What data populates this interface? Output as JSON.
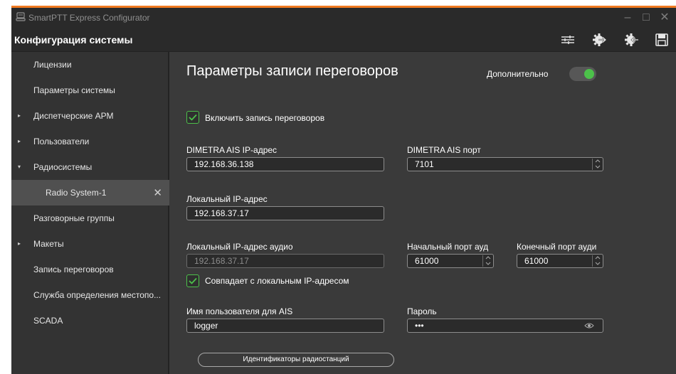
{
  "window": {
    "title": "SmartPTT Express Configurator",
    "accent_color": "#f07a21",
    "controls": {
      "minimize": "–",
      "maximize": "□",
      "close": "✕"
    }
  },
  "toolbar": {
    "section_title": "Конфигурация системы",
    "buttons": [
      "settings-sliders-icon",
      "export-icon",
      "import-icon",
      "save-icon"
    ]
  },
  "sidebar": {
    "items": [
      {
        "label": "Лицензии",
        "caret": ""
      },
      {
        "label": "Параметры системы",
        "caret": ""
      },
      {
        "label": "Диспетчерские АРМ",
        "caret": "▸"
      },
      {
        "label": "Пользователи",
        "caret": "▸"
      },
      {
        "label": "Радиосистемы",
        "caret": "▾"
      },
      {
        "label": "Radio System-1",
        "caret": "",
        "close": "✕"
      },
      {
        "label": "Разговорные группы",
        "caret": ""
      },
      {
        "label": "Макеты",
        "caret": "▸"
      },
      {
        "label": "Запись переговоров",
        "caret": ""
      },
      {
        "label": "Служба определения местопо...",
        "caret": ""
      },
      {
        "label": "SCADA",
        "caret": ""
      }
    ]
  },
  "main": {
    "title": "Параметры записи переговоров",
    "advanced_label": "Дополнительно",
    "advanced_on": true,
    "enable_recording": {
      "label": "Включить запись переговоров",
      "checked": true
    },
    "ais_ip": {
      "label": "DIMETRA AIS IP-адрес",
      "value": "192.168.36.138"
    },
    "ais_port": {
      "label": "DIMETRA AIS порт",
      "value": "7101"
    },
    "local_ip": {
      "label": "Локальный IP-адрес",
      "value": "192.168.37.17"
    },
    "local_audio_ip": {
      "label": "Локальный IP-адрес аудио",
      "value": "192.168.37.17"
    },
    "start_port": {
      "label": "Начальный порт ауд",
      "value": "61000"
    },
    "end_port": {
      "label": "Конечный порт ауди",
      "value": "61000"
    },
    "same_as_local": {
      "label": "Совпадает с локальным IP-адресом",
      "checked": true
    },
    "username": {
      "label": "Имя пользователя для AIS",
      "value": "logger"
    },
    "password": {
      "label": "Пароль",
      "value": "•••"
    },
    "ids_button": "Идентификаторы радиостанций"
  }
}
